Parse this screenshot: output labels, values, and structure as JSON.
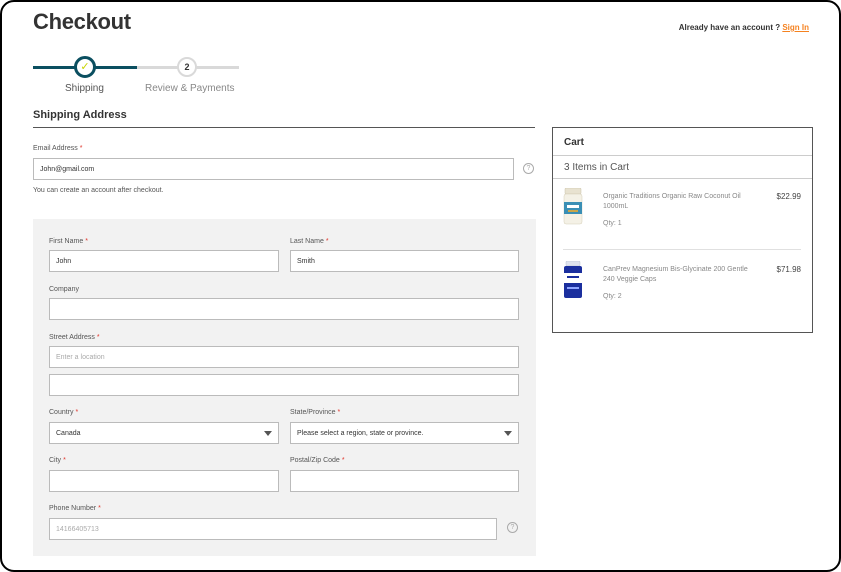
{
  "header": {
    "title": "Checkout",
    "account_prompt": "Already have an account ?",
    "sign_in": "Sign In"
  },
  "progress": {
    "steps": [
      {
        "label": "Shipping",
        "status": "complete",
        "number": ""
      },
      {
        "label": "Review & Payments",
        "status": "pending",
        "number": "2"
      }
    ]
  },
  "shipping": {
    "section_title": "Shipping Address",
    "email": {
      "label": "Email Address",
      "value": "John@gmail.com",
      "required": "*"
    },
    "account_note": "You can create an account after checkout.",
    "first_name": {
      "label": "First Name",
      "value": "John",
      "required": "*"
    },
    "last_name": {
      "label": "Last Name",
      "value": "Smith",
      "required": "*"
    },
    "company": {
      "label": "Company",
      "value": ""
    },
    "street": {
      "label": "Street Address",
      "placeholder": "Enter a location",
      "required": "*",
      "line2": ""
    },
    "country": {
      "label": "Country",
      "value": "Canada",
      "required": "*"
    },
    "state": {
      "label": "State/Province",
      "value": "Please select a region, state or province.",
      "required": "*"
    },
    "city": {
      "label": "City",
      "value": "",
      "required": "*"
    },
    "postal": {
      "label": "Postal/Zip Code",
      "value": "",
      "required": "*"
    },
    "phone": {
      "label": "Phone Number",
      "placeholder": "14166405713",
      "required": "*"
    }
  },
  "cart": {
    "title": "Cart",
    "count_text": "3 Items in Cart",
    "items": [
      {
        "name": "Organic Traditions Organic Raw Coconut Oil 1000mL",
        "price": "$22.99",
        "qty": "Qty: 1"
      },
      {
        "name": "CanPrev Magnesium Bis-Glycinate 200 Gentle 240 Veggie Caps",
        "price": "$71.98",
        "qty": "Qty: 2"
      }
    ]
  },
  "colors": {
    "accent": "#0b4f60",
    "link": "#f58220",
    "required": "#e0352b",
    "check": "#c9d400"
  }
}
